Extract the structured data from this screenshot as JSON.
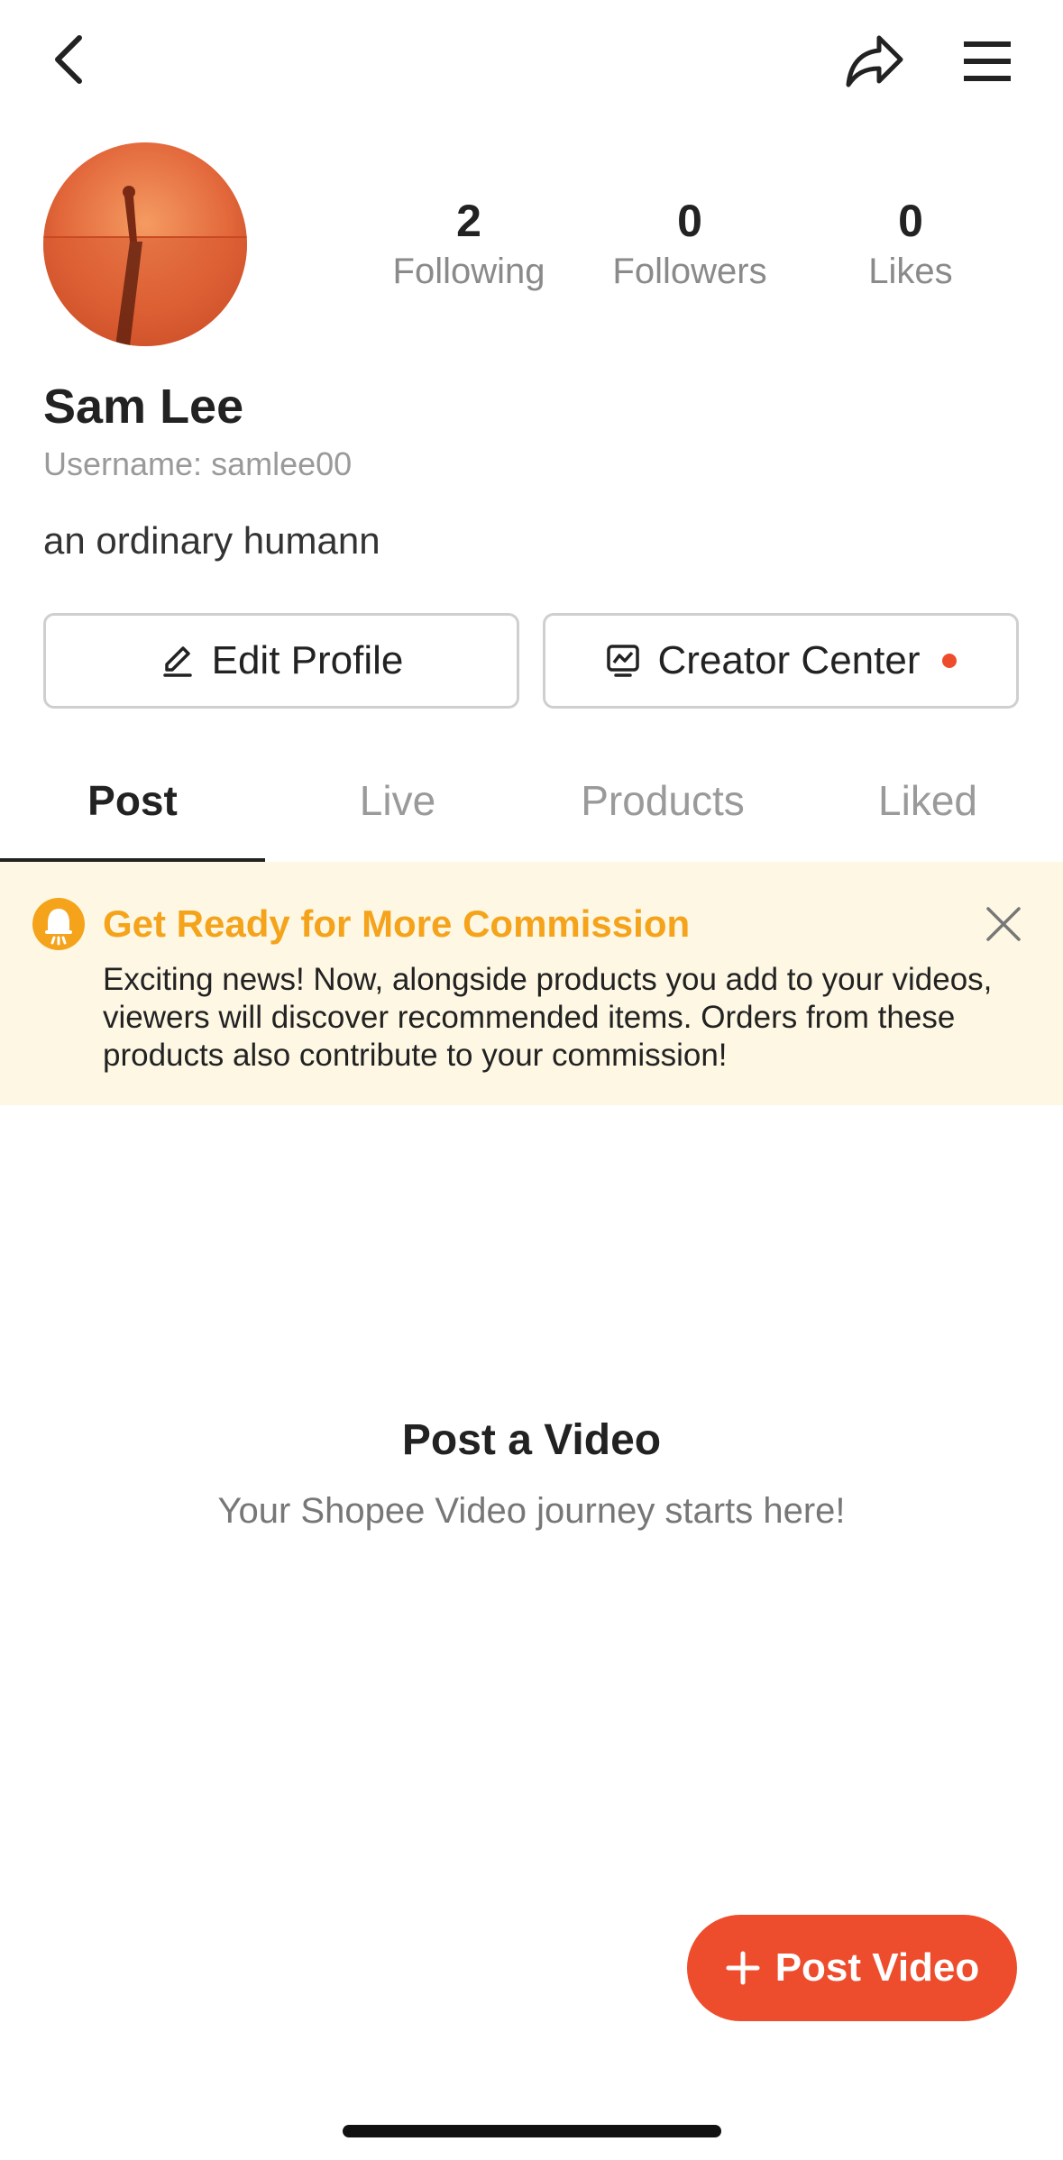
{
  "topbar": {
    "back_icon": "chevron-left-icon",
    "share_icon": "share-icon",
    "menu_icon": "hamburger-menu-icon"
  },
  "profile": {
    "name": "Sam Lee",
    "username": "Username: samlee00",
    "bio": "an ordinary humann",
    "stats": [
      {
        "value": "2",
        "label": "Following"
      },
      {
        "value": "0",
        "label": "Followers"
      },
      {
        "value": "0",
        "label": "Likes"
      }
    ]
  },
  "actions": {
    "edit_label": "Edit Profile",
    "creator_label": "Creator Center"
  },
  "tabs": [
    {
      "label": "Post",
      "active": true
    },
    {
      "label": "Live",
      "active": false
    },
    {
      "label": "Products",
      "active": false
    },
    {
      "label": "Liked",
      "active": false
    }
  ],
  "banner": {
    "title": "Get Ready for More Commission",
    "text": "Exciting news! Now, alongside products you add to your videos, viewers will discover recommended items. Orders from these products also contribute to your commission!"
  },
  "empty_state": {
    "title": "Post a Video",
    "subtitle": "Your Shopee Video journey starts here!"
  },
  "fab": {
    "label": "Post Video"
  },
  "colors": {
    "accent": "#ee4d2d",
    "banner_bg": "#fdf7e3",
    "banner_title": "#f4a31a"
  }
}
